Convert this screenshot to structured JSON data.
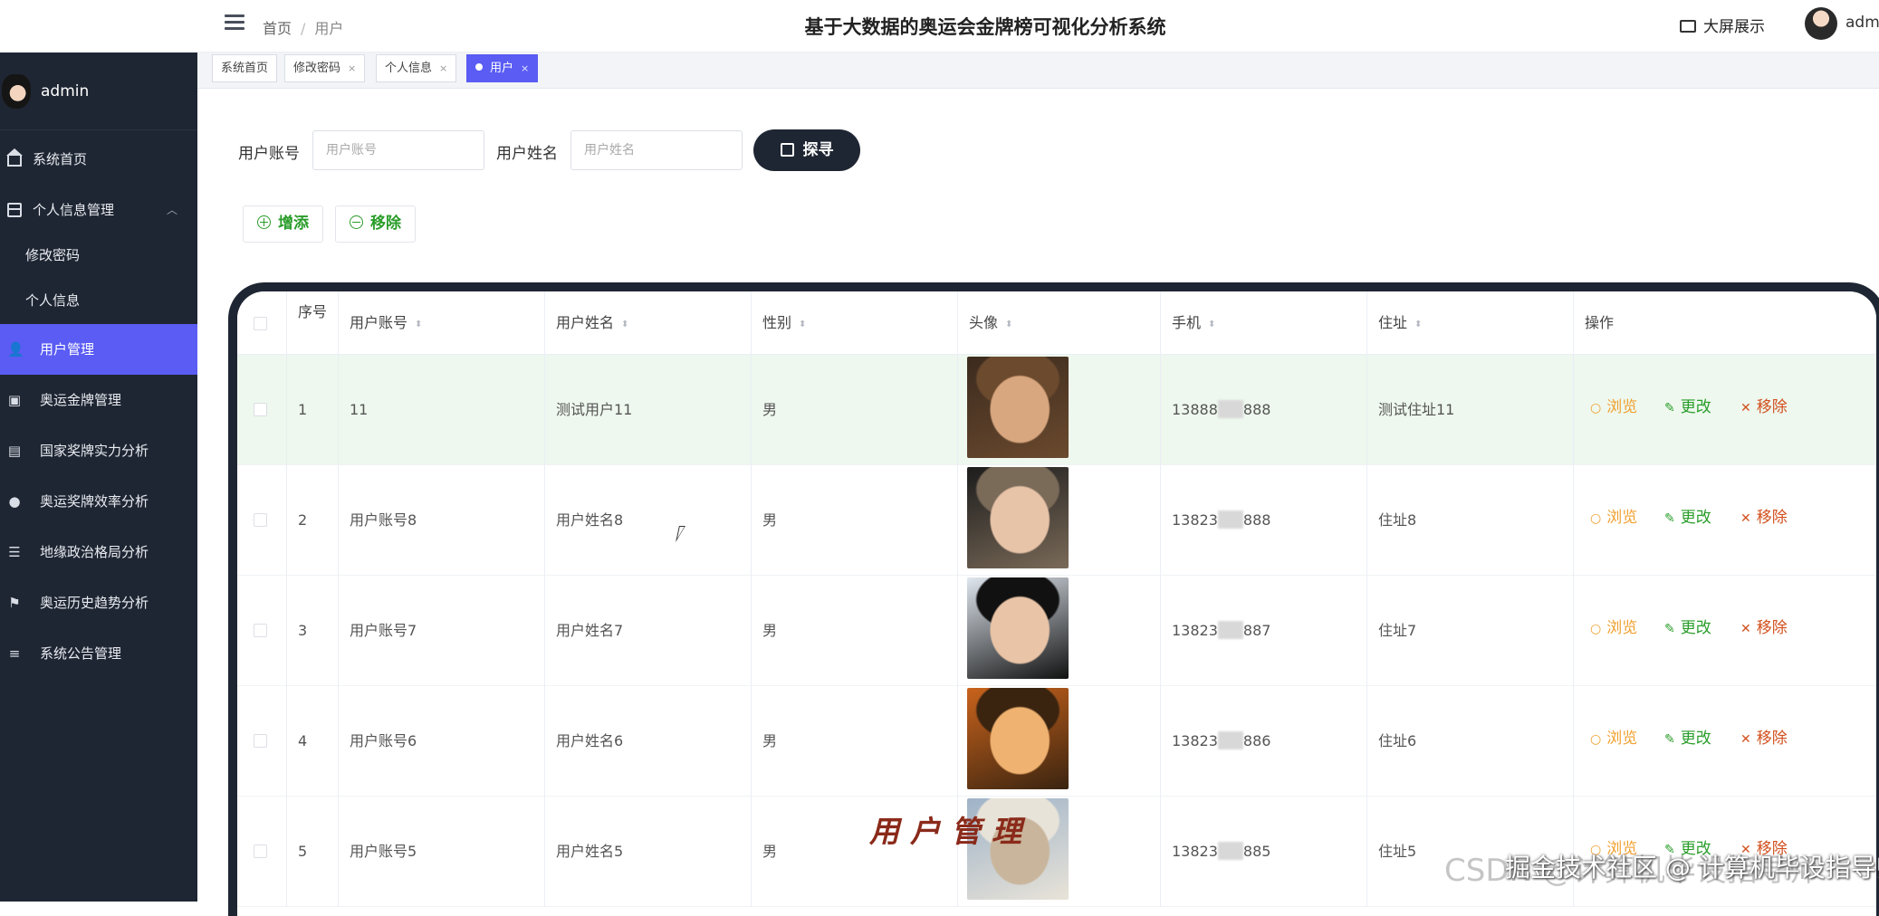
{
  "header": {
    "breadcrumb": [
      "首页",
      "用户"
    ],
    "breadcrumb_sep": "/",
    "system_title": "基于大数据的奥运会金牌榜可视化分析系统",
    "big_screen_label": "大屏展示",
    "user_name": "adm"
  },
  "tabs": [
    {
      "label": "系统首页",
      "closable": false
    },
    {
      "label": "修改密码",
      "closable": true
    },
    {
      "label": "个人信息",
      "closable": true
    },
    {
      "label": "用户",
      "closable": true,
      "active": true
    }
  ],
  "sidebar": {
    "user": "admin",
    "items": [
      {
        "label": "系统首页",
        "icon": "home-icon"
      },
      {
        "label": "个人信息管理",
        "icon": "profile-icon",
        "expanded": true
      },
      {
        "label": "修改密码",
        "sub": true
      },
      {
        "label": "个人信息",
        "sub": true
      },
      {
        "label": "用户管理",
        "icon": "user-icon",
        "active": true
      },
      {
        "label": "奥运金牌管理",
        "icon": "clipboard-icon"
      },
      {
        "label": "国家奖牌实力分析",
        "icon": "card-icon"
      },
      {
        "label": "奥运奖牌效率分析",
        "icon": "bulb-icon"
      },
      {
        "label": "地缘政治格局分析",
        "icon": "sliders-icon"
      },
      {
        "label": "奥运历史趋势分析",
        "icon": "flag-icon"
      },
      {
        "label": "系统公告管理",
        "icon": "list-icon"
      }
    ]
  },
  "search": {
    "account_label": "用户账号",
    "account_placeholder": "用户账号",
    "name_label": "用户姓名",
    "name_placeholder": "用户姓名",
    "button_label": "探寻"
  },
  "actions": {
    "add_label": "增添",
    "remove_label": "移除"
  },
  "table": {
    "columns": [
      "序号",
      "用户账号",
      "用户姓名",
      "性别",
      "头像",
      "手机",
      "住址",
      "操作"
    ],
    "op_labels": {
      "view": "浏览",
      "edit": "更改",
      "delete": "移除"
    },
    "rows": [
      {
        "seq": "1",
        "account": "11",
        "name": "测试用户11",
        "gender": "男",
        "phone_prefix": "13888",
        "phone_suffix": "888",
        "address": "测试住址11"
      },
      {
        "seq": "2",
        "account": "用户账号8",
        "name": "用户姓名8",
        "gender": "男",
        "phone_prefix": "13823",
        "phone_suffix": "888",
        "address": "住址8"
      },
      {
        "seq": "3",
        "account": "用户账号7",
        "name": "用户姓名7",
        "gender": "男",
        "phone_prefix": "13823",
        "phone_suffix": "887",
        "address": "住址7"
      },
      {
        "seq": "4",
        "account": "用户账号6",
        "name": "用户姓名6",
        "gender": "男",
        "phone_prefix": "13823",
        "phone_suffix": "886",
        "address": "住址6"
      },
      {
        "seq": "5",
        "account": "用户账号5",
        "name": "用户姓名5",
        "gender": "男",
        "phone_prefix": "13823",
        "phone_suffix": "885",
        "address": "住址5"
      }
    ]
  },
  "overlay_title": "用户管理",
  "watermark": {
    "back": "CSDN @计算机毕设指导师",
    "front": "掘金技术社区 @ 计算机毕设指导师"
  },
  "colors": {
    "sidebar_bg": "#1f2633",
    "accent": "#5a5cf3",
    "view": "#f0a030",
    "edit": "#2a9d2a",
    "delete": "#d2501e"
  }
}
